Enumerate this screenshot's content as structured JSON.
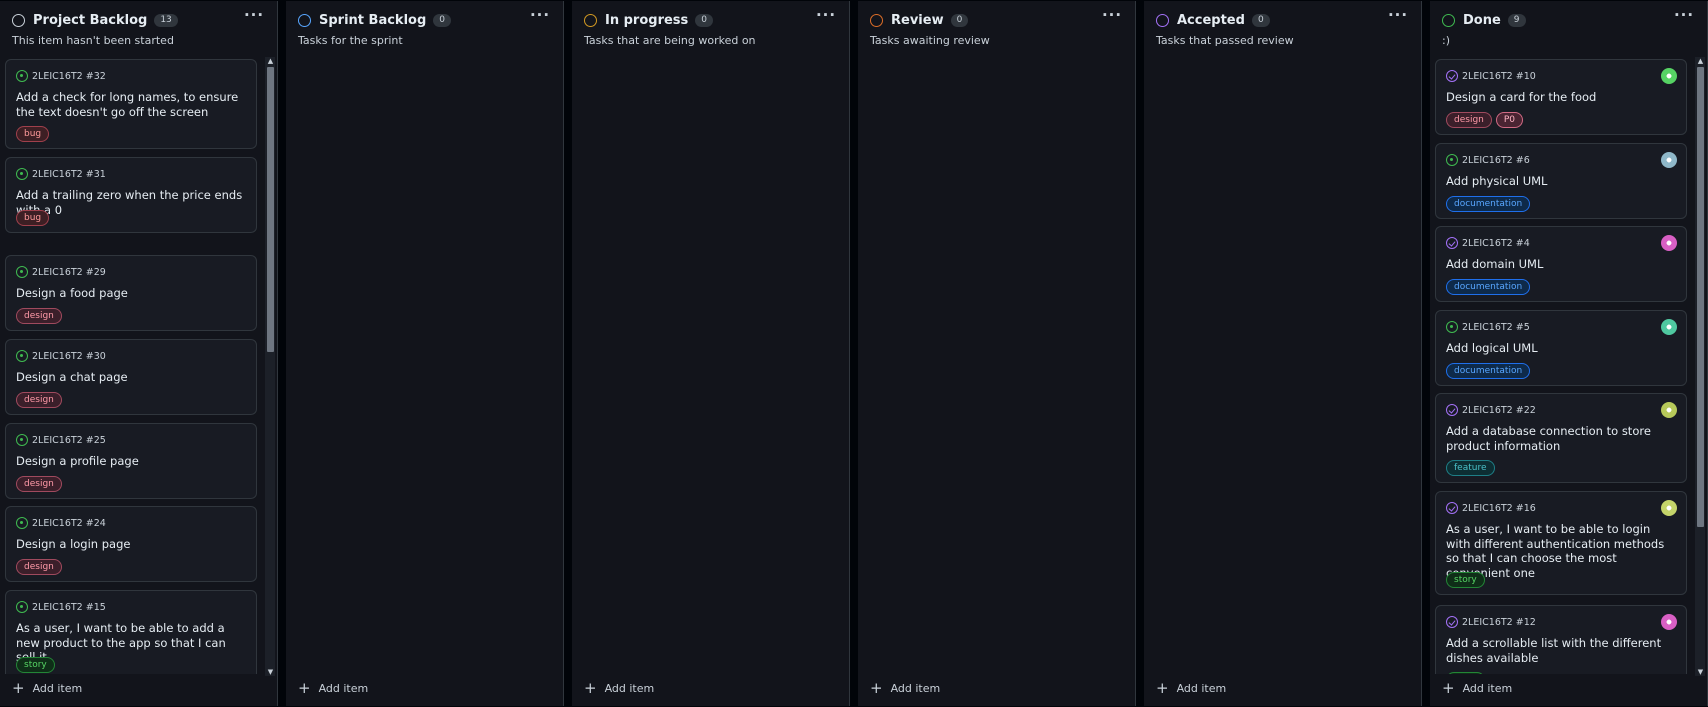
{
  "columns": [
    {
      "title": "Project Backlog",
      "count": "13",
      "description": "This item hasn't been started",
      "dot_color": "#c9d1d9",
      "add_label": "Add item",
      "cards": [
        {
          "meta": "2LEIC16T2 #32",
          "title": "Add a check for long names, to ensure the text doesn't go off the screen",
          "labels": [
            "bug"
          ],
          "state": "open"
        },
        {
          "meta": "2LEIC16T2 #31",
          "title": "Add a trailing zero when the price ends with a 0",
          "labels": [
            "bug"
          ],
          "state": "open"
        },
        {
          "meta": "2LEIC16T2 #29",
          "title": "Design a food page",
          "labels": [
            "design"
          ],
          "state": "open"
        },
        {
          "meta": "2LEIC16T2 #30",
          "title": "Design a chat page",
          "labels": [
            "design"
          ],
          "state": "open"
        },
        {
          "meta": "2LEIC16T2 #25",
          "title": "Design a profile page",
          "labels": [
            "design"
          ],
          "state": "open"
        },
        {
          "meta": "2LEIC16T2 #24",
          "title": "Design a login page",
          "labels": [
            "design"
          ],
          "state": "open"
        },
        {
          "meta": "2LEIC16T2 #15",
          "title": "As a user, I want to be able to add a new product to the app so that I can sell it.",
          "labels": [
            "story"
          ],
          "state": "open"
        }
      ]
    },
    {
      "title": "Sprint Backlog",
      "count": "0",
      "description": "Tasks for the sprint",
      "dot_color": "#58a6ff",
      "add_label": "Add item",
      "cards": []
    },
    {
      "title": "In progress",
      "count": "0",
      "description": "Tasks that are being worked on",
      "dot_color": "#d29922",
      "add_label": "Add item",
      "cards": []
    },
    {
      "title": "Review",
      "count": "0",
      "description": "Tasks awaiting review",
      "dot_color": "#db6d28",
      "add_label": "Add item",
      "cards": []
    },
    {
      "title": "Accepted",
      "count": "0",
      "description": "Tasks that passed review",
      "dot_color": "#a371f7",
      "add_label": "Add item",
      "cards": []
    },
    {
      "title": "Done",
      "count": "9",
      "description": ":)",
      "dot_color": "#3fb950",
      "add_label": "Add item",
      "cards": [
        {
          "meta": "2LEIC16T2 #10",
          "title": "Design a card for the food",
          "labels": [
            "design",
            "P0"
          ],
          "state": "closed",
          "avatar": "#56d364"
        },
        {
          "meta": "2LEIC16T2 #6",
          "title": "Add physical UML",
          "labels": [
            "documentation"
          ],
          "state": "open",
          "avatar": "#8fb8c9"
        },
        {
          "meta": "2LEIC16T2 #4",
          "title": "Add domain UML",
          "labels": [
            "documentation"
          ],
          "state": "closed",
          "avatar": "#d85fc4"
        },
        {
          "meta": "2LEIC16T2 #5",
          "title": "Add logical UML",
          "labels": [
            "documentation"
          ],
          "state": "open",
          "avatar": "#4fc8a0"
        },
        {
          "meta": "2LEIC16T2 #22",
          "title": "Add a database connection to store product information",
          "labels": [
            "feature"
          ],
          "state": "closed",
          "avatar": "#b7c95a"
        },
        {
          "meta": "2LEIC16T2 #16",
          "title": "As a user, I want to be able to login with different authentication methods so that I can choose the most convenient one",
          "labels": [
            "story"
          ],
          "state": "closed",
          "avatar": "#c4d46a"
        },
        {
          "meta": "2LEIC16T2 #12",
          "title": "Add a scrollable list with the different dishes available",
          "labels": [
            "story"
          ],
          "state": "closed",
          "avatar": "#d85fc4"
        }
      ]
    }
  ]
}
